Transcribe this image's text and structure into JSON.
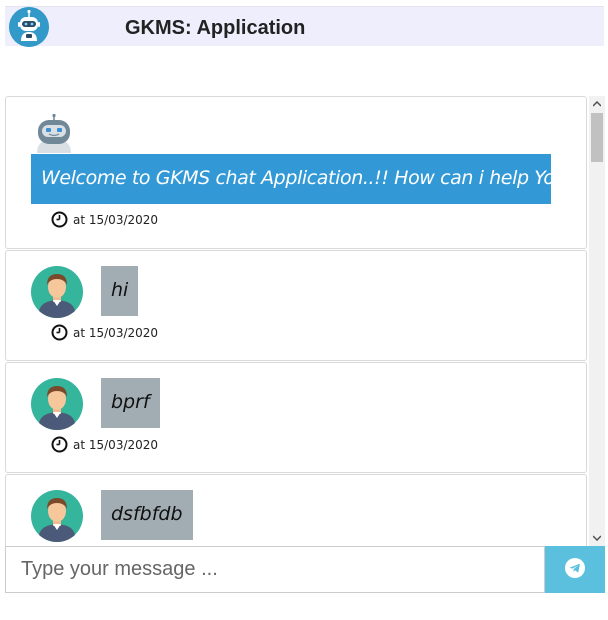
{
  "header": {
    "title": "GKMS: Application",
    "logo_icon": "robot-icon"
  },
  "messages": [
    {
      "sender": "bot",
      "avatar_icon": "robot-icon",
      "text": "Welcome to GKMS chat Application..!! How can i help You",
      "timestamp": "at 15/03/2020"
    },
    {
      "sender": "user",
      "avatar_icon": "user-avatar-icon",
      "text": "hi",
      "timestamp": "at 15/03/2020"
    },
    {
      "sender": "user",
      "avatar_icon": "user-avatar-icon",
      "text": "bprf",
      "timestamp": "at 15/03/2020"
    },
    {
      "sender": "user",
      "avatar_icon": "user-avatar-icon",
      "text": "dsfbfdb",
      "timestamp": ""
    }
  ],
  "input": {
    "placeholder": "Type your message ...",
    "value": ""
  },
  "send_button": {
    "icon": "telegram-send-icon"
  },
  "colors": {
    "header_bg": "#eeeefc",
    "bot_bubble": "#3399d6",
    "user_bubble": "#a2adb3",
    "send_button": "#5bc0de",
    "logo_bg": "#3399c9"
  }
}
